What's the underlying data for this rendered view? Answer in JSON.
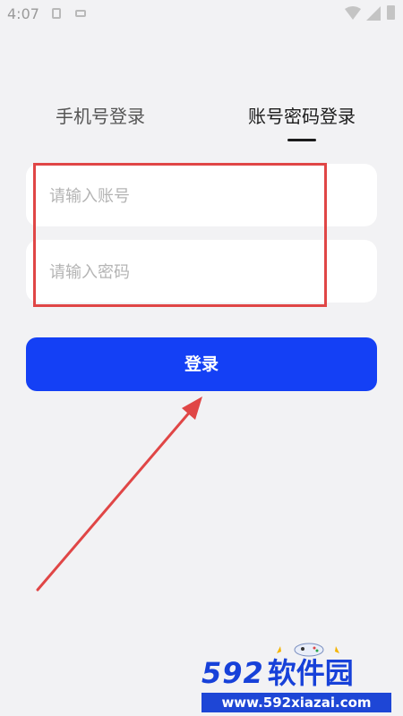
{
  "status_bar": {
    "time": "4:07"
  },
  "tabs": [
    {
      "label": "手机号登录",
      "active": false
    },
    {
      "label": "账号密码登录",
      "active": true
    }
  ],
  "form": {
    "account_placeholder": "请输入账号",
    "account_value": "",
    "password_placeholder": "请输入密码",
    "password_value": ""
  },
  "login_button": {
    "label": "登录"
  },
  "watermark": {
    "digits": "592",
    "name": "软件园",
    "url": "www.592xiazai.com"
  },
  "colors": {
    "accent": "#1440f5",
    "highlight": "#e04646",
    "background": "#f2f2f4"
  }
}
